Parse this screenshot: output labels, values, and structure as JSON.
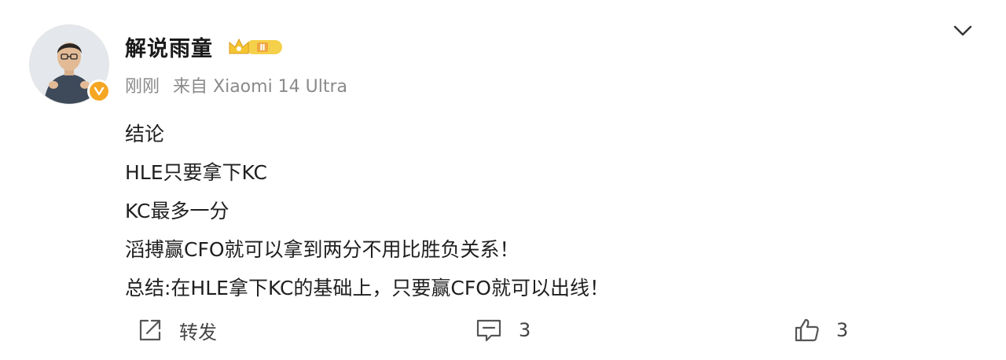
{
  "user": {
    "name": "解说雨童",
    "timestamp": "刚刚",
    "source": "来自 Xiaomi 14 Ultra",
    "badge_level": "Ⅱ"
  },
  "post": {
    "lines": [
      "结论",
      "HLE只要拿下KC",
      "KC最多一分",
      "滔搏赢CFO就可以拿到两分不用比胜负关系！",
      "总结:在HLE拿下KC的基础上，只要赢CFO就可以出线！"
    ]
  },
  "actions": {
    "repost_label": "转发",
    "comment_count": "3",
    "like_count": "3"
  },
  "colors": {
    "verified": "#f5a623",
    "badge_gold": "#f3c531",
    "meta_text": "#8a8a8a"
  },
  "icons": [
    "verified-icon",
    "crown-badge-icon",
    "chevron-down-icon",
    "repost-icon",
    "comment-icon",
    "like-icon"
  ]
}
